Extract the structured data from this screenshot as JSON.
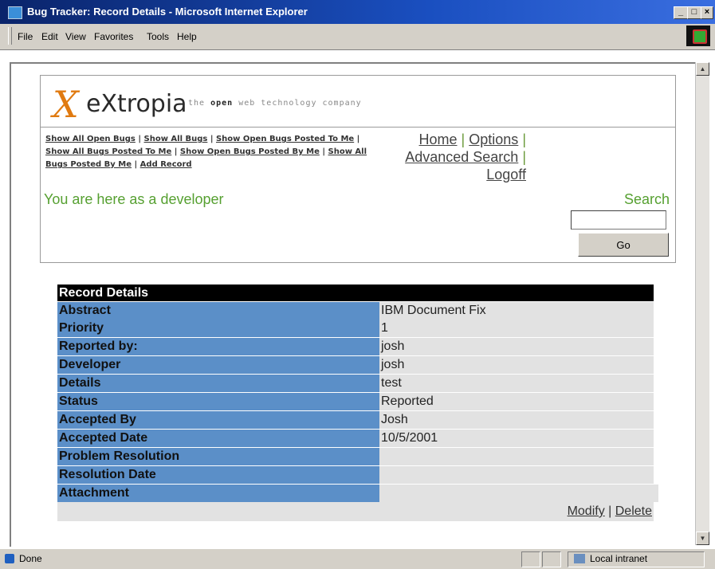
{
  "window": {
    "title": "Bug Tracker: Record Details - Microsoft Internet Explorer"
  },
  "menu": [
    "File",
    "Edit",
    "View",
    "Favorites",
    "Tools",
    "Help"
  ],
  "header": {
    "logo_text": "eXtropia",
    "tagline_pre": "the ",
    "tagline_bold": "open",
    "tagline_post": " web technology company",
    "small_links": [
      "Show All Open Bugs",
      "Show All Bugs",
      "Show Open Bugs Posted To Me",
      "Show All Bugs Posted To Me",
      "Show Open Bugs Posted By Me",
      "Show All Bugs Posted By Me",
      "Add Record"
    ],
    "big_links": {
      "home": "Home",
      "options": "Options",
      "advanced_search": "Advanced Search",
      "logoff": "Logoff"
    },
    "you_are_here": "You are here as a developer",
    "search_label": "Search",
    "search_value": "",
    "go_label": "Go"
  },
  "record": {
    "title": "Record Details",
    "rows": [
      {
        "label": "Abstract",
        "value": "IBM Document Fix"
      },
      {
        "label": "Priority",
        "value": "1"
      },
      {
        "label": "Reported by:",
        "value": "josh"
      },
      {
        "label": "Developer",
        "value": "josh"
      },
      {
        "label": "Details",
        "value": "test"
      },
      {
        "label": "Status",
        "value": "Reported"
      },
      {
        "label": "Accepted By",
        "value": "Josh"
      },
      {
        "label": "Accepted Date",
        "value": "10/5/2001"
      },
      {
        "label": "Problem Resolution",
        "value": ""
      },
      {
        "label": "Resolution Date",
        "value": ""
      },
      {
        "label": "Attachment",
        "value": ""
      }
    ],
    "modify_label": "Modify",
    "delete_label": "Delete"
  },
  "status": {
    "text": "Done",
    "zone": "Local intranet"
  }
}
